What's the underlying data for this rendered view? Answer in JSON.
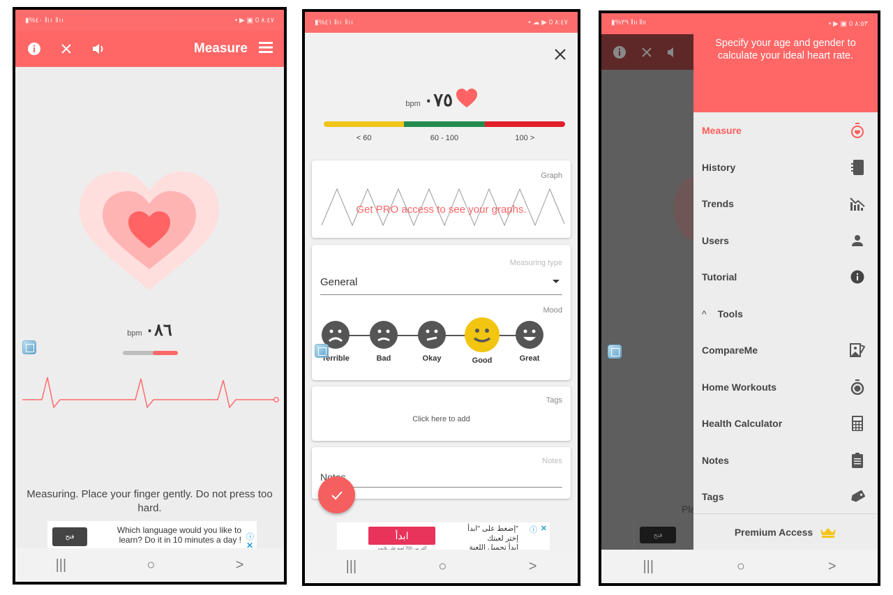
{
  "screens": [
    {
      "status": {
        "left": "▮%٤٠ ‖ıı ‖ıı",
        "right": "• ▶ ▣ 0 ٨:٤٧"
      },
      "appbar": {
        "title": "Measure",
        "icons": [
          "info-icon",
          "close-icon",
          "volume-icon",
          "menu-icon"
        ]
      },
      "bpm": {
        "value": "٠٨٦",
        "unit": "bpm"
      },
      "progress_fraction": 0.45,
      "hint": "Measuring. Place your finger gently. Do not press too hard.",
      "ad": {
        "button": "فتح",
        "text": "Which language would you like to learn? Do it in 10 minutes a day !"
      }
    },
    {
      "status": {
        "left": "▮%٤١ ‖ıı ‖ıı",
        "right": "• ☁ ▶ 0 ٨:٤٧"
      },
      "bpm": {
        "value": "٠٧٥",
        "unit": "bpm"
      },
      "ranges": [
        {
          "label": "< 60",
          "color": "#f0c419"
        },
        {
          "label": "60 - 100",
          "color": "#238b4e"
        },
        {
          "label": "100 >",
          "color": "#e11f2a"
        }
      ],
      "graph": {
        "label": "Graph",
        "message": "Get PRO access to see your graphs."
      },
      "measuring_type": {
        "label": "Measuring type",
        "value": "General"
      },
      "mood": {
        "label": "Mood",
        "options": [
          "Terrible",
          "Bad",
          "Okay",
          "Good",
          "Great"
        ],
        "selected": "Good"
      },
      "tags": {
        "label": "Tags",
        "placeholder": "Click here to add"
      },
      "notes": {
        "label": "Notes",
        "placeholder": "Notes"
      },
      "ad": {
        "button": "ابدأ",
        "subtext": "أكثر من 700 لعبة على بلايويز",
        "lines": [
          "\"إضغط على \"ابدأ",
          "إختر لعبتك",
          "ابدأ تحميل اللعبة"
        ]
      }
    },
    {
      "status": {
        "left": "▮%٣٩ ‖ıı ‖ıı",
        "right": "• ▶ ▣ 0 ٨:٥٣"
      },
      "drawer": {
        "header": "Specify your age and gender to calculate your ideal heart rate.",
        "items": [
          {
            "label": "Measure",
            "icon": "stopwatch-heart-icon",
            "active": true
          },
          {
            "label": "History",
            "icon": "notebook-icon"
          },
          {
            "label": "Trends",
            "icon": "trend-chart-icon"
          },
          {
            "label": "Users",
            "icon": "person-icon"
          },
          {
            "label": "Tutorial",
            "icon": "info-icon"
          }
        ],
        "tools_label": "Tools",
        "tools": [
          {
            "label": "CompareMe",
            "icon": "photo-compare-icon"
          },
          {
            "label": "Home Workouts",
            "icon": "timer-icon"
          },
          {
            "label": "Health Calculator",
            "icon": "calculator-icon"
          },
          {
            "label": "Notes",
            "icon": "clipboard-icon"
          },
          {
            "label": "Tags",
            "icon": "tag-icon"
          }
        ],
        "premium": "Premium Access"
      },
      "behind": {
        "hint_fragment": "Pla",
        "ad_button": "فتح"
      }
    }
  ],
  "navbar": {
    "recent": "|||",
    "home": "○",
    "back": ">"
  },
  "colors": {
    "accent": "#ff6666",
    "mood_selected": "#f2c511",
    "premium_crown": "#f5c518"
  }
}
